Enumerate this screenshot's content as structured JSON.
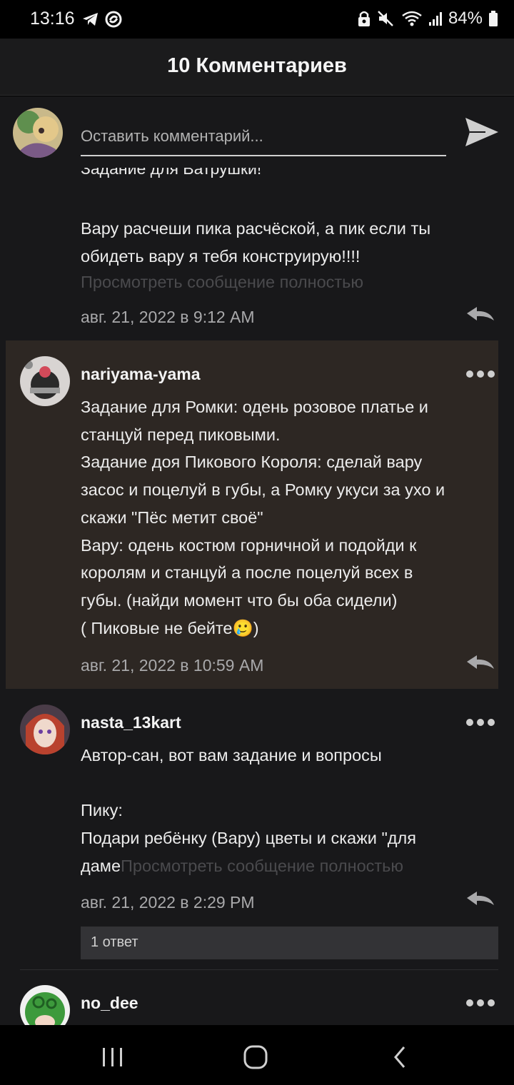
{
  "status_bar": {
    "time": "13:16",
    "battery": "84%"
  },
  "header": {
    "title": "10 Комментариев"
  },
  "compose": {
    "placeholder": "Оставить комментарий..."
  },
  "comments": [
    {
      "clipped_line": "Задание для Ватрушки!",
      "body": "Вару расчеши пика расчёской, а пик если ты обидеть вару я тебя конструирую!!!!",
      "more_link": "Просмотреть сообщение полностью",
      "timestamp": "авг. 21, 2022 в 9:12 AM"
    },
    {
      "username": "nariyama-yama",
      "lines": [
        "Задание для Ромки: одень розовое платье и",
        "станцуй перед пиковыми.",
        "Задание доя Пикового Короля: сделай вару",
        "засос и поцелуй в губы, а Ромку укуси за ухо и",
        "скажи \"Пёс метит своё\"",
        "Вару: одень костюм горничной и подойди к",
        "королям и станцуй а после поцелуй всех в",
        "губы. (найди момент что бы оба сидели)"
      ],
      "last_line_before": "( Пиковые не бейте",
      "emoji": "🥲",
      "last_line_after": ")",
      "timestamp": "авг. 21, 2022 в 10:59 AM"
    },
    {
      "username": "nasta_13kart",
      "line1": "Автор-сан, вот вам задание и вопросы",
      "line2": "Пику:",
      "line3": "Подари ребёнку (Вару) цветы и скажи \"для",
      "line4_start": "даме",
      "more_link": "Просмотреть сообщение полностью",
      "timestamp": "авг. 21, 2022 в 2:29 PM",
      "replies_label": "1 ответ"
    },
    {
      "username": "no_dee"
    }
  ],
  "icons": {
    "telegram": "telegram-icon",
    "sync": "sync-icon",
    "lock": "lock-icon",
    "mute": "mute-icon",
    "wifi": "wifi-icon",
    "signal": "signal-icon",
    "battery": "battery-icon",
    "send": "send-icon",
    "reply": "reply-icon",
    "more": "more-icon",
    "nav_recents": "recents-icon",
    "nav_home": "home-icon",
    "nav_back": "back-icon"
  },
  "colors": {
    "background": "#18181a",
    "highlight": "#2d2723",
    "muted_link": "#4a4a4d"
  }
}
